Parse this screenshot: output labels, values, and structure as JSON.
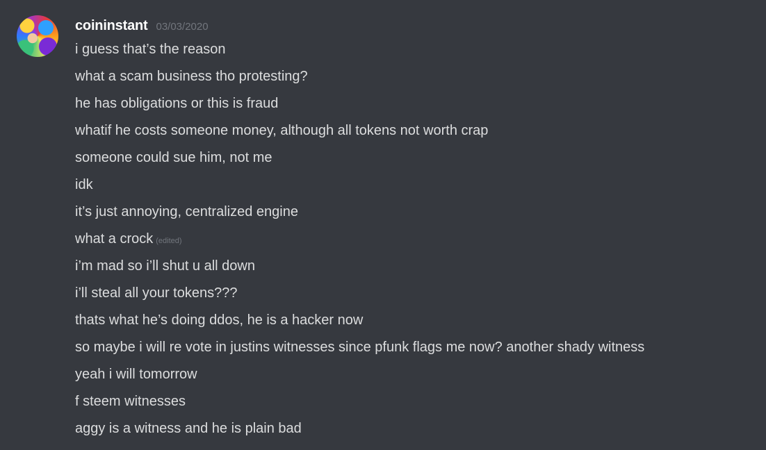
{
  "message": {
    "author": "coininstant",
    "timestamp": "03/03/2020",
    "avatar_icon": "user-avatar",
    "edited_label": "(edited)",
    "lines": [
      "i guess that’s the reason",
      "what a scam business tho protesting?",
      "he has obligations or this is fraud",
      "whatif he costs someone money, although all tokens not worth crap",
      "someone could sue him, not me",
      "idk",
      "it’s just annoying, centralized engine",
      "what a crock",
      "i’m mad so i’ll shut u all down",
      "i’ll steal all your tokens???",
      "thats what he’s doing ddos, he is a hacker now",
      "so maybe i will re vote in justins witnesses since pfunk flags me now? another shady witness",
      "yeah i will tomorrow",
      "f steem witnesses",
      "aggy is a witness and he is plain bad"
    ]
  },
  "colors": {
    "background": "#36393f",
    "text": "#dcddde",
    "username": "#ffffff",
    "muted": "#72767d"
  }
}
